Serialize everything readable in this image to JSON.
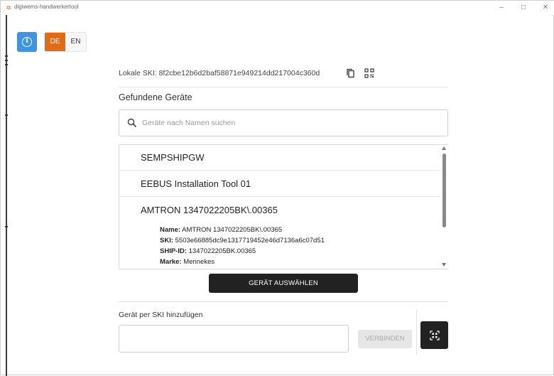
{
  "window": {
    "title": "digiwems-handwerkertool"
  },
  "toolbar": {
    "languages": [
      {
        "code": "DE",
        "active": true
      },
      {
        "code": "EN",
        "active": false
      }
    ]
  },
  "ski": {
    "label": "Lokale SKI:",
    "value": "8f2cbe12b6d2baf58871e949214dd217004c360d"
  },
  "devices": {
    "section_title": "Gefundene Geräte",
    "search_placeholder": "Geräte nach Namen suchen",
    "items": [
      {
        "name": "SEMPSHIPGW"
      },
      {
        "name": "EEBUS Installation Tool 01"
      },
      {
        "name": "AMTRON 1347022205BK\\.00365",
        "details": {
          "name_label": "Name:",
          "name_value": "AMTRON 1347022205BK\\.00365",
          "ski_label": "SKI:",
          "ski_value": "5503e66885dc9e1317719452e46d7136a6c07d51",
          "shipid_label": "SHIP-ID:",
          "shipid_value": "1347022205BK.00365",
          "brand_label": "Marke:",
          "brand_value": "Mennekes"
        }
      }
    ],
    "select_button": "GERÄT AUSWÄHLEN"
  },
  "add_by_ski": {
    "label": "Gerät per SKI hinzufügen",
    "connect_button": "VERBINDEN",
    "input_value": ""
  },
  "colors": {
    "accent_orange": "#e26c14",
    "info_blue": "#3f93e2",
    "dark_button": "#222222"
  }
}
